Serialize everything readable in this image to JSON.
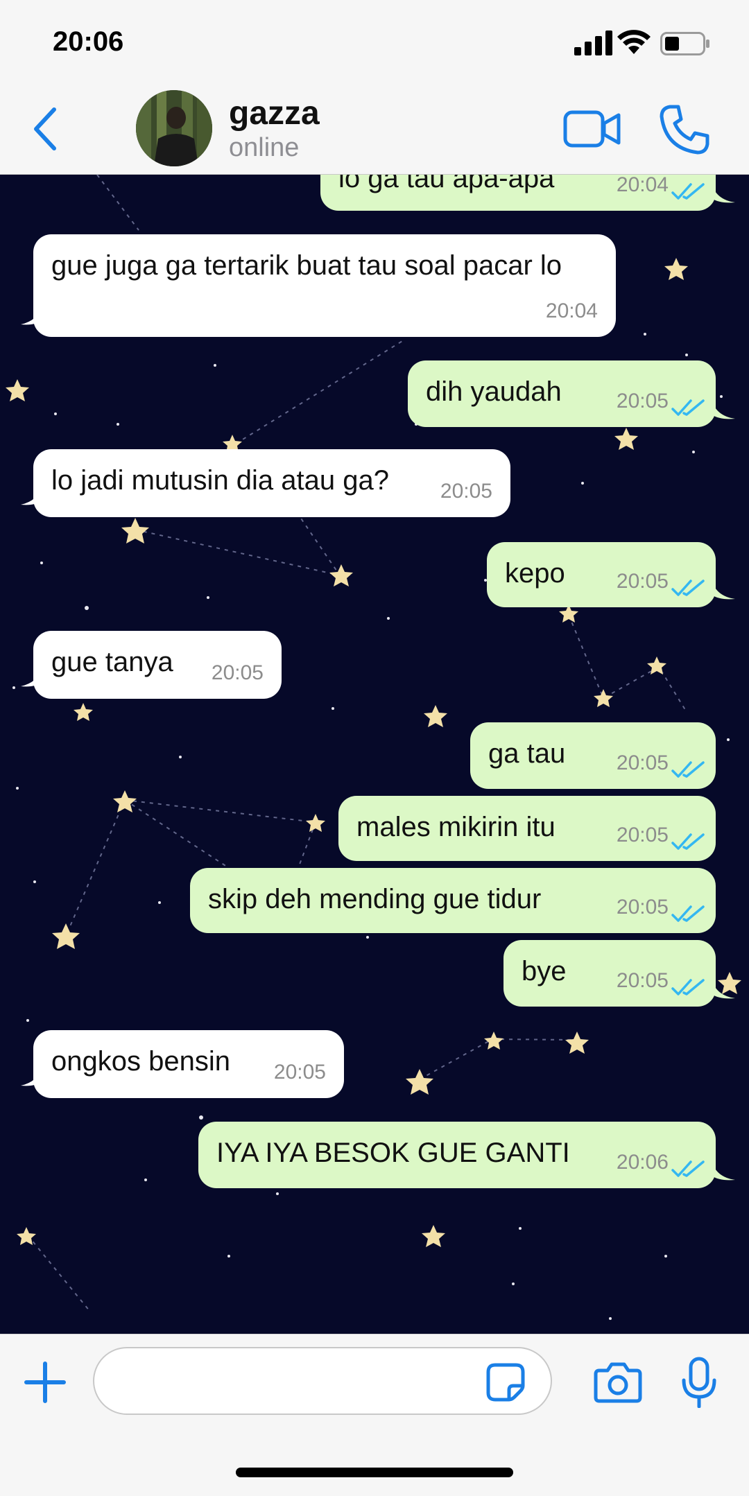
{
  "status_bar": {
    "time": "20:06"
  },
  "header": {
    "contact_name": "gazza",
    "contact_status": "online"
  },
  "messages": [
    {
      "direction": "out",
      "text": "lo ga tau apa-apa",
      "time": "20:04",
      "read": true
    },
    {
      "direction": "in",
      "text": "gue juga ga tertarik buat tau soal pacar lo",
      "time": "20:04"
    },
    {
      "direction": "out",
      "text": "dih yaudah",
      "time": "20:05",
      "read": true
    },
    {
      "direction": "in",
      "text": "lo jadi mutusin dia atau ga?",
      "time": "20:05"
    },
    {
      "direction": "out",
      "text": "kepo",
      "time": "20:05",
      "read": true
    },
    {
      "direction": "in",
      "text": "gue tanya",
      "time": "20:05"
    },
    {
      "direction": "out",
      "text": "ga tau",
      "time": "20:05",
      "read": true
    },
    {
      "direction": "out",
      "text": "males mikirin itu",
      "time": "20:05",
      "read": true
    },
    {
      "direction": "out",
      "text": "skip deh mending gue tidur",
      "time": "20:05",
      "read": true
    },
    {
      "direction": "out",
      "text": "bye",
      "time": "20:05",
      "read": true
    },
    {
      "direction": "in",
      "text": "ongkos bensin",
      "time": "20:05"
    },
    {
      "direction": "out",
      "text": "IYA IYA BESOK GUE GANTI",
      "time": "20:06",
      "read": true
    }
  ],
  "input": {
    "value": "",
    "placeholder": ""
  },
  "icons": {
    "back": "chevron-left-icon",
    "video": "video-camera-icon",
    "call": "phone-icon",
    "plus": "plus-icon",
    "sticker": "sticker-icon",
    "camera": "camera-icon",
    "mic": "microphone-icon",
    "read_receipt": "double-check-icon"
  },
  "colors": {
    "accent": "#1a7fe6",
    "incoming_bubble": "#ffffff",
    "outgoing_bubble": "#dcf8c6",
    "chat_background": "#060929",
    "read_tick": "#34b7f1"
  }
}
